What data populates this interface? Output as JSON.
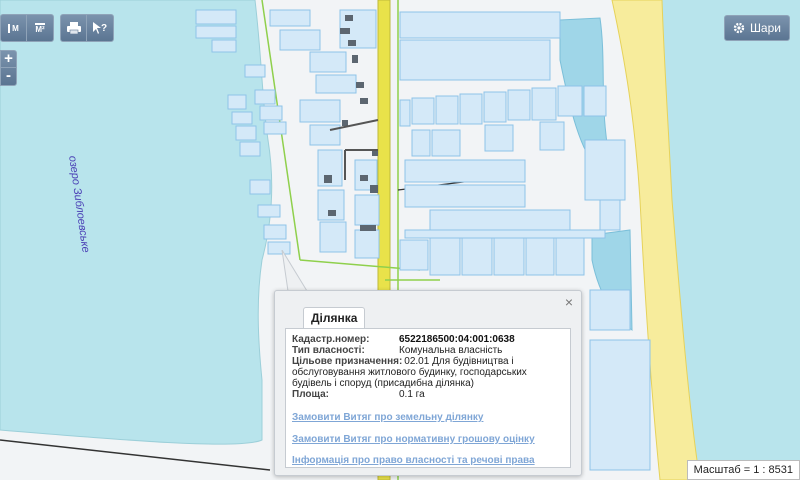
{
  "toolbar": {
    "group1": [
      {
        "name": "measure-m-tool",
        "label": "M"
      },
      {
        "name": "measure-area-tool",
        "label": "M²"
      }
    ],
    "group2": [
      {
        "name": "print-tool",
        "label": "print"
      },
      {
        "name": "identify-tool",
        "label": "?"
      }
    ]
  },
  "zoom": {
    "in": "+",
    "out": "-"
  },
  "layers": {
    "label": "Шари",
    "icon": "gear-icon"
  },
  "map": {
    "lake_label": "озеро Зиблоевське"
  },
  "popup": {
    "tab": "Ділянка",
    "close": "×",
    "fields": {
      "cadastral_label": "Кадастр.номер:",
      "cadastral_value": "6522186500:04:001:0638",
      "ownership_label": "Тип власності:",
      "ownership_value": "Комунальна власність",
      "purpose_label": "Цільове призначення:",
      "purpose_value": "02.01 Для будівництва і обслуговування житлового будинку, господарських будівель і споруд (присадибна ділянка)",
      "area_label": "Площа:",
      "area_value": "0.1 га"
    },
    "links": [
      "Замовити Витяг про земельну ділянку",
      "Замовити Витяг про нормативну грошову оцінку",
      "Інформація про право власності та речові права"
    ]
  },
  "scale": {
    "text": "Масштаб = 1 : 8531"
  },
  "colors": {
    "water": "#b8e4ec",
    "land": "#f2f4f6",
    "beach": "#f7ec9c",
    "parcel_fill": "#d4e9f8",
    "parcel_stroke": "#8ec3e8",
    "boundary": "#8fd04c"
  }
}
